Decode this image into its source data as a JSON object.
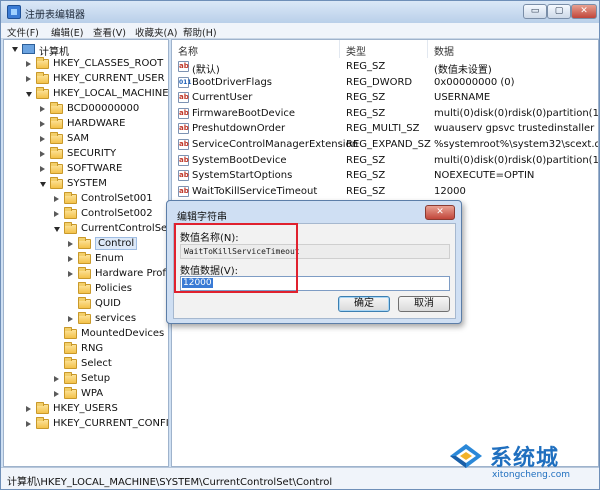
{
  "window": {
    "title": "注册表编辑器",
    "min_label": "▭",
    "max_label": "▢",
    "close_label": "✕"
  },
  "menu": [
    "文件(F)",
    "编辑(E)",
    "查看(V)",
    "收藏夹(A)",
    "帮助(H)"
  ],
  "tree": [
    {
      "label": "计算机",
      "icon": "computer-icon",
      "expander": "open"
    },
    {
      "label": "HKEY_CLASSES_ROOT",
      "icon": "folder-icon",
      "expander": "closed"
    },
    {
      "label": "HKEY_CURRENT_USER",
      "icon": "folder-icon",
      "expander": "closed"
    },
    {
      "label": "HKEY_LOCAL_MACHINE",
      "icon": "folder-icon",
      "expander": "open"
    },
    {
      "label": "BCD00000000",
      "icon": "folder-icon",
      "expander": "closed"
    },
    {
      "label": "HARDWARE",
      "icon": "folder-icon",
      "expander": "closed"
    },
    {
      "label": "SAM",
      "icon": "folder-icon",
      "expander": "closed"
    },
    {
      "label": "SECURITY",
      "icon": "folder-icon",
      "expander": "closed"
    },
    {
      "label": "SOFTWARE",
      "icon": "folder-icon",
      "expander": "closed"
    },
    {
      "label": "SYSTEM",
      "icon": "folder-icon",
      "expander": "open"
    },
    {
      "label": "ControlSet001",
      "icon": "folder-icon",
      "expander": "closed"
    },
    {
      "label": "ControlSet002",
      "icon": "folder-icon",
      "expander": "closed"
    },
    {
      "label": "CurrentControlSet",
      "icon": "folder-icon",
      "expander": "open"
    },
    {
      "label": "Control",
      "icon": "folder-icon",
      "expander": "closed",
      "selected": true
    },
    {
      "label": "Enum",
      "icon": "folder-icon",
      "expander": "closed"
    },
    {
      "label": "Hardware Profil",
      "icon": "folder-icon",
      "expander": "closed"
    },
    {
      "label": "Policies",
      "icon": "folder-icon",
      "expander": "none"
    },
    {
      "label": "QUID",
      "icon": "folder-icon",
      "expander": "none"
    },
    {
      "label": "services",
      "icon": "folder-icon",
      "expander": "closed"
    },
    {
      "label": "MountedDevices",
      "icon": "folder-icon",
      "expander": "none"
    },
    {
      "label": "RNG",
      "icon": "folder-icon",
      "expander": "none"
    },
    {
      "label": "Select",
      "icon": "folder-icon",
      "expander": "none"
    },
    {
      "label": "Setup",
      "icon": "folder-icon",
      "expander": "closed"
    },
    {
      "label": "WPA",
      "icon": "folder-icon",
      "expander": "closed"
    },
    {
      "label": "HKEY_USERS",
      "icon": "folder-icon",
      "expander": "closed"
    },
    {
      "label": "HKEY_CURRENT_CONFIG",
      "icon": "folder-icon",
      "expander": "closed"
    }
  ],
  "list": {
    "headers": [
      "名称",
      "类型",
      "数据"
    ],
    "rows": [
      {
        "name": "(默认)",
        "type": "REG_SZ",
        "data": "(数值未设置)",
        "icon": "ab"
      },
      {
        "name": "BootDriverFlags",
        "type": "REG_DWORD",
        "data": "0x00000000 (0)",
        "icon": "bin"
      },
      {
        "name": "CurrentUser",
        "type": "REG_SZ",
        "data": "USERNAME",
        "icon": "ab"
      },
      {
        "name": "FirmwareBootDevice",
        "type": "REG_SZ",
        "data": "multi(0)disk(0)rdisk(0)partition(1)",
        "icon": "ab"
      },
      {
        "name": "PreshutdownOrder",
        "type": "REG_MULTI_SZ",
        "data": "wuauserv gpsvc trustedinstaller",
        "icon": "ab"
      },
      {
        "name": "ServiceControlManagerExtension",
        "type": "REG_EXPAND_SZ",
        "data": "%systemroot%\\system32\\scext.dll",
        "icon": "ab"
      },
      {
        "name": "SystemBootDevice",
        "type": "REG_SZ",
        "data": "multi(0)disk(0)rdisk(0)partition(1)",
        "icon": "ab"
      },
      {
        "name": "SystemStartOptions",
        "type": "REG_SZ",
        "data": " NOEXECUTE=OPTIN",
        "icon": "ab"
      },
      {
        "name": "WaitToKillServiceTimeout",
        "type": "REG_SZ",
        "data": "12000",
        "icon": "ab"
      }
    ]
  },
  "dialog": {
    "title": "编辑字符串",
    "close_label": "✕",
    "name_label": "数值名称(N):",
    "name_value": "WaitToKillServiceTimeout",
    "data_label": "数值数据(V):",
    "data_value": "12000",
    "ok_label": "确定",
    "cancel_label": "取消"
  },
  "statusbar": {
    "path": "计算机\\HKEY_LOCAL_MACHINE\\SYSTEM\\CurrentControlSet\\Control"
  },
  "watermark": {
    "text": "系统城",
    "url": "xitongcheng.com"
  }
}
